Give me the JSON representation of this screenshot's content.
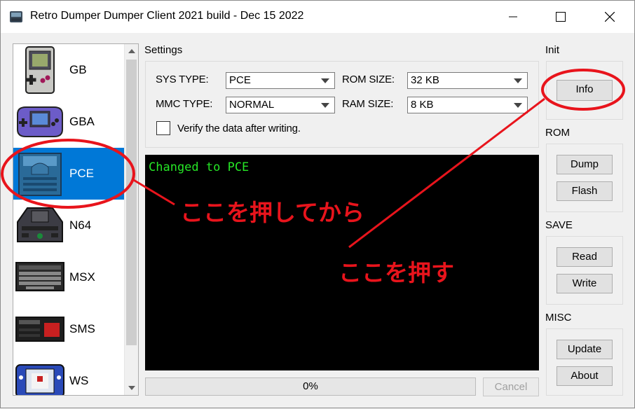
{
  "window": {
    "title": "Retro Dumper Dumper Client 2021 build - Dec 15 2022",
    "controls": [
      "minimize",
      "maximize",
      "close"
    ]
  },
  "systems": [
    {
      "label": "GB",
      "icon": "gameboy-icon",
      "selected": false
    },
    {
      "label": "GBA",
      "icon": "gameboy-advance-icon",
      "selected": false
    },
    {
      "label": "PCE",
      "icon": "pc-engine-icon",
      "selected": true
    },
    {
      "label": "N64",
      "icon": "nintendo64-icon",
      "selected": false
    },
    {
      "label": "MSX",
      "icon": "msx-icon",
      "selected": false
    },
    {
      "label": "SMS",
      "icon": "master-system-icon",
      "selected": false
    },
    {
      "label": "WS",
      "icon": "wonderswan-icon",
      "selected": false
    }
  ],
  "settings": {
    "group_label": "Settings",
    "sys_type": {
      "label": "SYS TYPE:",
      "value": "PCE"
    },
    "mmc_type": {
      "label": "MMC TYPE:",
      "value": "NORMAL"
    },
    "rom_size": {
      "label": "ROM SIZE:",
      "value": "32 KB"
    },
    "ram_size": {
      "label": "RAM SIZE:",
      "value": "8 KB"
    },
    "verify": {
      "label": "Verify the data after writing.",
      "checked": false
    }
  },
  "console": {
    "lines": [
      "Changed to PCE"
    ],
    "text_color": "#26e626"
  },
  "progress": {
    "text": "0%",
    "value": 0
  },
  "cancel_label": "Cancel",
  "side": {
    "init": {
      "label": "Init",
      "buttons": [
        "Info"
      ]
    },
    "rom": {
      "label": "ROM",
      "buttons": [
        "Dump",
        "Flash"
      ]
    },
    "save": {
      "label": "SAVE",
      "buttons": [
        "Read",
        "Write"
      ]
    },
    "misc": {
      "label": "MISC",
      "buttons": [
        "Update",
        "About"
      ]
    }
  },
  "annotations": {
    "press_first": "ここを押してから",
    "press_then": "ここを押す",
    "color": "#e8141c"
  }
}
